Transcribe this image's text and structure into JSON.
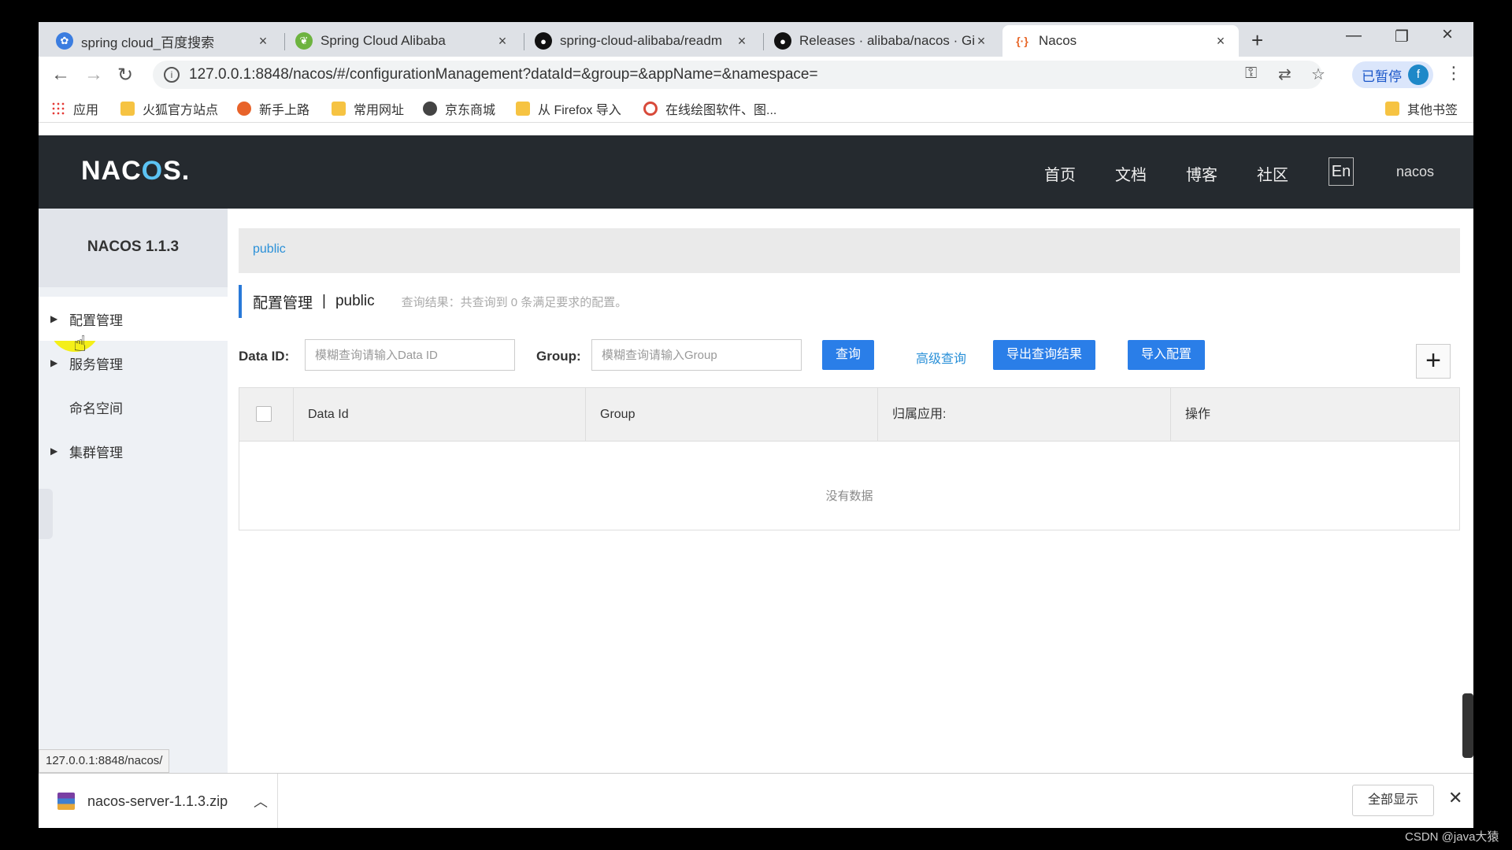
{
  "browser": {
    "tabs": [
      {
        "title": "spring cloud_百度搜索",
        "icon": "paw-icon"
      },
      {
        "title": "Spring Cloud Alibaba",
        "icon": "spring-leaf-icon"
      },
      {
        "title": "spring-cloud-alibaba/readm",
        "icon": "github-icon"
      },
      {
        "title": "Releases · alibaba/nacos · Gi",
        "icon": "github-icon"
      },
      {
        "title": "Nacos",
        "icon": "nacos-icon"
      }
    ],
    "url": "127.0.0.1:8848/nacos/#/configurationManagement?dataId=&group=&appName=&namespace=",
    "profile_status": "已暂停",
    "profile_initial": "f",
    "bookmarks": [
      "应用",
      "火狐官方站点",
      "新手上路",
      "常用网址",
      "京东商城",
      "从 Firefox 导入",
      "在线绘图软件、图...",
      "其他书签"
    ]
  },
  "header": {
    "logo_pre": "NAC",
    "logo_o": "O",
    "logo_post": "S.",
    "nav": [
      "首页",
      "文档",
      "博客",
      "社区"
    ],
    "lang": "En",
    "user": "nacos"
  },
  "sidebar": {
    "version": "NACOS 1.1.3",
    "items": [
      "配置管理",
      "服务管理",
      "命名空间",
      "集群管理"
    ]
  },
  "main": {
    "namespace": "public",
    "title": "配置管理",
    "title_ns": "public",
    "result_hint": "查询结果：共查询到 0 条满足要求的配置。",
    "data_id_label": "Data ID:",
    "data_id_placeholder": "模糊查询请输入Data ID",
    "group_label": "Group:",
    "group_placeholder": "模糊查询请输入Group",
    "query_btn": "查询",
    "advanced_query": "高级查询",
    "export_btn": "导出查询结果",
    "import_btn": "导入配置",
    "add_btn": "+",
    "columns": [
      "Data Id",
      "Group",
      "归属应用:",
      "操作"
    ],
    "empty_text": "没有数据"
  },
  "status_url": "127.0.0.1:8848/nacos/",
  "download": {
    "filename": "nacos-server-1.1.3.zip",
    "show_all": "全部显示"
  },
  "watermark": "CSDN @java大猿"
}
